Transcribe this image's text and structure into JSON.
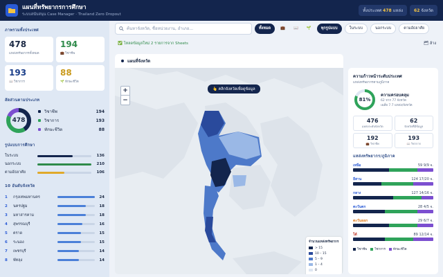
{
  "header": {
    "title": "แผนที่ทรัพยากรการศึกษา",
    "subtitle": "ระบบสนับสนุน Case Manager · Thailand Zero Dropout",
    "stat_schools_prefix": "ทั้งประเทศ",
    "stat_schools_value": "478",
    "stat_schools_suffix": "แหล่ง",
    "stat_provinces_value": "62",
    "stat_provinces_suffix": "จังหวัด"
  },
  "sidebar": {
    "overview_title": "ภาพรวมทั้งประเทศ",
    "cards": [
      {
        "value": "478",
        "label": "แหล่งทรัพยากรทั้งหมด",
        "color": "#1c2a45"
      },
      {
        "value": "194",
        "label": "💼 วิชาชีพ",
        "color": "#2f8a4a"
      },
      {
        "value": "193",
        "label": "📖 วิชาการ",
        "color": "#1c3f8a"
      },
      {
        "value": "88",
        "label": "🌱 ทักษะชีวิต",
        "color": "#c99a1c"
      }
    ],
    "ratio_title": "สัดส่วนตามประเภท",
    "donut_total": "478",
    "donut_items": [
      {
        "label": "วิชาชีพ",
        "value": "194",
        "color": "#13254d"
      },
      {
        "label": "วิชาการ",
        "value": "193",
        "color": "#2fa35a"
      },
      {
        "label": "ทักษะชีวิต",
        "value": "88",
        "color": "#7c4fd0"
      }
    ],
    "type_title": "รูปแบบการศึกษา",
    "types": [
      {
        "label": "ในระบบ",
        "value": "136",
        "fraction": 0.65,
        "color": "#13254d"
      },
      {
        "label": "นอกระบบ",
        "value": "210",
        "fraction": 1.0,
        "color": "#2f8a4a"
      },
      {
        "label": "ตามอัธยาศัย",
        "value": "106",
        "fraction": 0.5,
        "color": "#e0a92a"
      }
    ],
    "top_title": "10 อันดับจังหวัด",
    "provinces": [
      {
        "rank": "1",
        "name": "กรุงเทพมหานคร",
        "value": "24",
        "fraction": 1.0
      },
      {
        "rank": "2",
        "name": "นครปฐม",
        "value": "18",
        "fraction": 0.75
      },
      {
        "rank": "3",
        "name": "มหาสารคาม",
        "value": "18",
        "fraction": 0.75
      },
      {
        "rank": "4",
        "name": "สุพรรณบุรี",
        "value": "16",
        "fraction": 0.67
      },
      {
        "rank": "5",
        "name": "ตราด",
        "value": "15",
        "fraction": 0.63
      },
      {
        "rank": "6",
        "name": "ระนอง",
        "value": "15",
        "fraction": 0.63
      },
      {
        "rank": "7",
        "name": "เพชรบุรี",
        "value": "14",
        "fraction": 0.58
      },
      {
        "rank": "8",
        "name": "พัทลุง",
        "value": "14",
        "fraction": 0.58
      }
    ]
  },
  "toolbar": {
    "search_placeholder": "ค้นหาจังหวัด, ชื่อหน่วยงาน, อำเภอ...",
    "all_label": "ทั้งหมด",
    "btn_icon1": "💼",
    "btn_icon2": "📖",
    "btn_icon3": "🌱",
    "mode_all": "ทุกรูปแบบ",
    "mode_formal": "ในระบบ",
    "mode_nonformal": "นอกระบบ",
    "mode_informal": "ตามอัธยาศัย"
  },
  "notice": {
    "text": "✅ โหลดข้อมูลใหม่ 2 รายการจาก Sheets",
    "right": "🗂 ล้าง"
  },
  "map": {
    "title": "แผนที่จังหวัด",
    "chip": "👆 คลิกจังหวัดเพื่อดูข้อมูล",
    "zoom_in": "+",
    "zoom_out": "−",
    "legend_title": "จำนวนแหล่งทรัพยากร",
    "legend": [
      {
        "label": "> 15",
        "color": "#13254d"
      },
      {
        "label": "10 – 15",
        "color": "#2a4a9c"
      },
      {
        "label": "5 – 9",
        "color": "#4d79c9"
      },
      {
        "label": "1 – 4",
        "color": "#9ab8e6"
      },
      {
        "label": "0",
        "color": "#dfe7f3"
      }
    ]
  },
  "right": {
    "title": "ความก้าวหน้าระดับประเทศ",
    "subtitle": "แหล่งทรัพยากรตามภูมิภาค",
    "coverage_percent": "81%",
    "coverage_fraction": 0.81,
    "coverage_title": "ความครอบคลุม",
    "coverage_line1": "62 จาก 77 จังหวัด",
    "coverage_line2": "เฉลี่ย 7.7 แหล่ง/จังหวัด",
    "cards": [
      {
        "value": "476",
        "label": "แหล่งระดับจังหวัด"
      },
      {
        "value": "62",
        "label": "จังหวัดที่มีข้อมูล"
      },
      {
        "value": "192",
        "label": "💼 วิชาชีพ"
      },
      {
        "value": "193",
        "label": "📖 วิชาการ"
      }
    ],
    "region_title": "แหล่งทรัพยากร/ภูมิภาค",
    "regions": [
      {
        "name": "เหนือ",
        "value": "59",
        "sub": "9/9 จ.",
        "color": "#2a5bd6",
        "parts": [
          0.45,
          0.35,
          0.2
        ]
      },
      {
        "name": "อีสาน",
        "value": "124",
        "sub": "17/20 จ.",
        "color": "#2a5bd6",
        "parts": [
          0.35,
          0.4,
          0.25
        ]
      },
      {
        "name": "กลาง",
        "value": "127",
        "sub": "14/16 จ.",
        "color": "#2a5bd6",
        "parts": [
          0.5,
          0.35,
          0.15
        ]
      },
      {
        "name": "ตะวันตก",
        "value": "28",
        "sub": "4/5 จ.",
        "color": "#2a5bd6",
        "parts": [
          0.4,
          0.4,
          0.2
        ]
      },
      {
        "name": "ตะวันออก",
        "value": "29",
        "sub": "6/7 จ.",
        "color": "#e07b1a",
        "parts": [
          0.45,
          0.35,
          0.2
        ]
      },
      {
        "name": "ใต้",
        "value": "89",
        "sub": "12/14 จ.",
        "color": "#c0392b",
        "parts": [
          0.4,
          0.35,
          0.25
        ]
      }
    ],
    "legend": [
      {
        "label": "วิชาชีพ",
        "color": "#13254d"
      },
      {
        "label": "วิชาการ",
        "color": "#2fa35a"
      },
      {
        "label": "ทักษะชีวิต",
        "color": "#7c4fd0"
      }
    ]
  }
}
